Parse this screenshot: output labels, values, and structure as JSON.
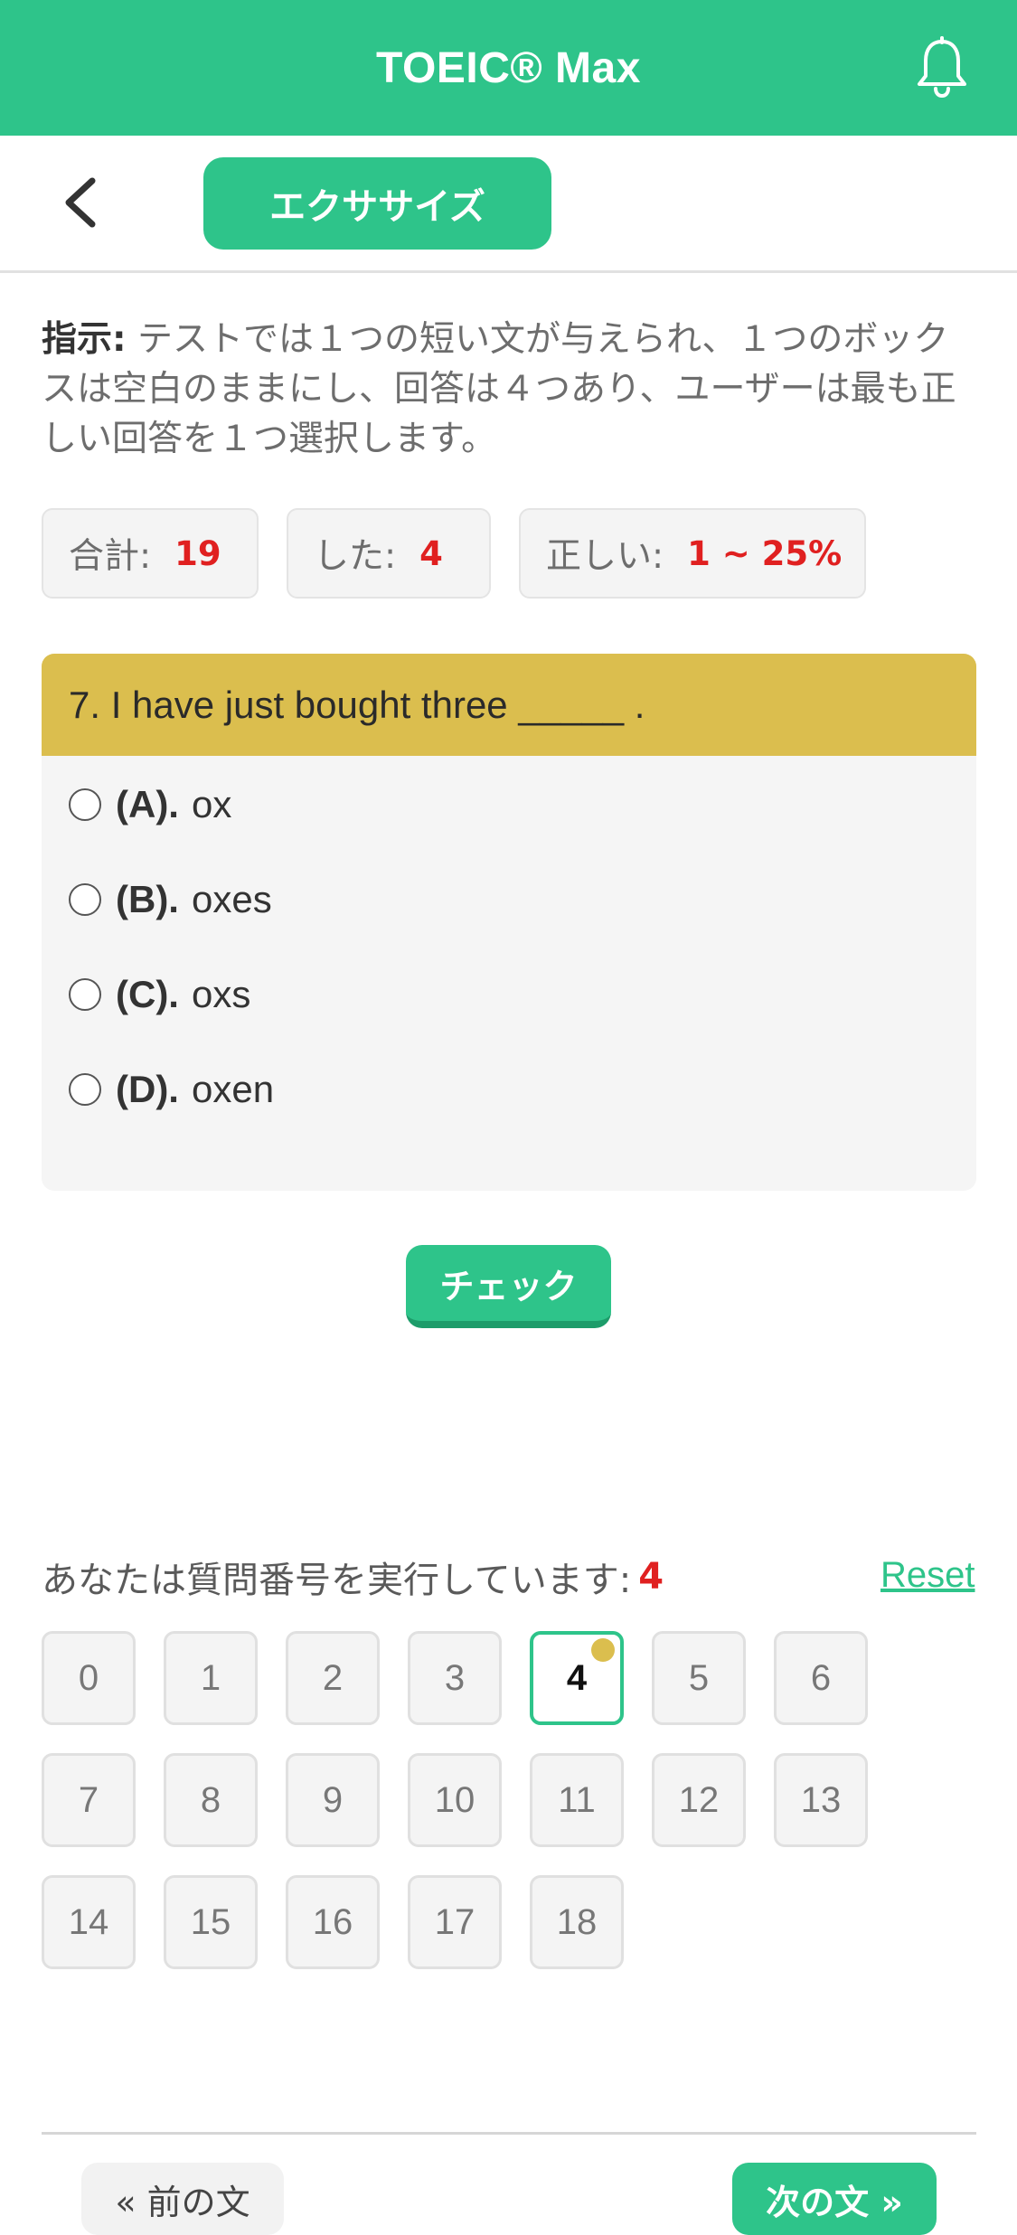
{
  "header": {
    "app_title": "TOEIC® Max",
    "notification_icon": "bell-icon"
  },
  "subheader": {
    "back_icon": "chevron-left-icon",
    "tab_label": "エクササイズ"
  },
  "instruction": {
    "label": "指示:",
    "text": " テストでは１つの短い文が与えられ、１つのボックスは空白のままにし、回答は４つあり、ユーザーは最も正しい回答を１つ選択します。"
  },
  "stats": {
    "total_label": "合計:",
    "total_value": "19",
    "done_label": "した:",
    "done_value": "4",
    "correct_label": "正しい:",
    "correct_value": "1 ~ 25%"
  },
  "question": {
    "text": "7. I have just bought three _____ .",
    "options": [
      {
        "letter": "(A).",
        "text": "ox"
      },
      {
        "letter": "(B).",
        "text": "oxes"
      },
      {
        "letter": "(C).",
        "text": "oxs"
      },
      {
        "letter": "(D).",
        "text": "oxen"
      }
    ]
  },
  "check_button": "チェック",
  "progress": {
    "text": "あなたは質問番号を実行しています:",
    "current": "4",
    "reset_label": "Reset",
    "numbers": [
      "0",
      "1",
      "2",
      "3",
      "4",
      "5",
      "6",
      "7",
      "8",
      "9",
      "10",
      "11",
      "12",
      "13",
      "14",
      "15",
      "16",
      "17",
      "18"
    ],
    "current_index": 4
  },
  "footer": {
    "prev_label": "« 前の文",
    "next_label": "次の文 »"
  },
  "colors": {
    "brand": "#2ec48a",
    "question_header": "#dbbe4e",
    "accent_red": "#e02020"
  }
}
